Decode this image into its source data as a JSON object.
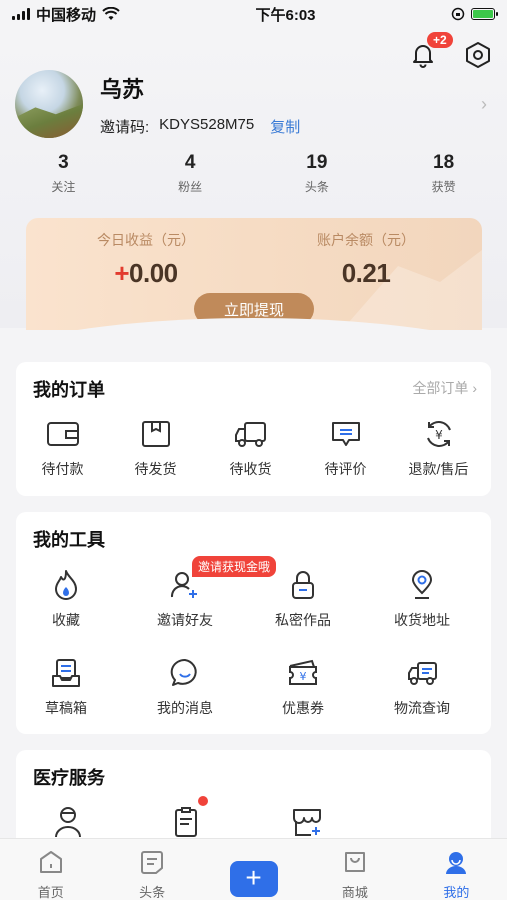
{
  "status_bar": {
    "carrier": "中国移动",
    "time": "下午6:03"
  },
  "notifications": {
    "badge": "+2"
  },
  "profile": {
    "name": "乌苏",
    "invite_label": "邀请码:",
    "invite_code": "KDYS528M75",
    "copy_label": "复制"
  },
  "stats": [
    {
      "value": "3",
      "label": "关注"
    },
    {
      "value": "4",
      "label": "粉丝"
    },
    {
      "value": "19",
      "label": "头条"
    },
    {
      "value": "18",
      "label": "获赞"
    }
  ],
  "earnings": {
    "today_label": "今日收益（元）",
    "today_value_sign": "+",
    "today_value": "0.00",
    "balance_label": "账户余额（元）",
    "balance_value": "0.21",
    "withdraw_label": "立即提现"
  },
  "orders": {
    "title": "我的订单",
    "all_label": "全部订单",
    "items": [
      {
        "label": "待付款",
        "icon": "wallet-icon"
      },
      {
        "label": "待发货",
        "icon": "box-icon"
      },
      {
        "label": "待收货",
        "icon": "truck-icon"
      },
      {
        "label": "待评价",
        "icon": "comment-icon"
      },
      {
        "label": "退款/售后",
        "icon": "refund-icon"
      }
    ]
  },
  "tools": {
    "title": "我的工具",
    "promo": "邀请获现金哦",
    "items": [
      {
        "label": "收藏",
        "icon": "flame-icon"
      },
      {
        "label": "邀请好友",
        "icon": "add-user-icon"
      },
      {
        "label": "私密作品",
        "icon": "lock-icon"
      },
      {
        "label": "收货地址",
        "icon": "location-icon"
      },
      {
        "label": "草稿箱",
        "icon": "draft-box-icon"
      },
      {
        "label": "我的消息",
        "icon": "message-icon"
      },
      {
        "label": "优惠券",
        "icon": "coupon-icon"
      },
      {
        "label": "物流查询",
        "icon": "logistics-icon"
      }
    ]
  },
  "medical": {
    "title": "医疗服务"
  },
  "tab_bar": {
    "items": [
      {
        "label": "首页",
        "icon": "home-icon"
      },
      {
        "label": "头条",
        "icon": "news-icon"
      },
      {
        "label": "",
        "icon": "plus-icon"
      },
      {
        "label": "商城",
        "icon": "shop-icon"
      },
      {
        "label": "我的",
        "icon": "profile-icon"
      }
    ],
    "active_color": "#2f6fe8"
  }
}
